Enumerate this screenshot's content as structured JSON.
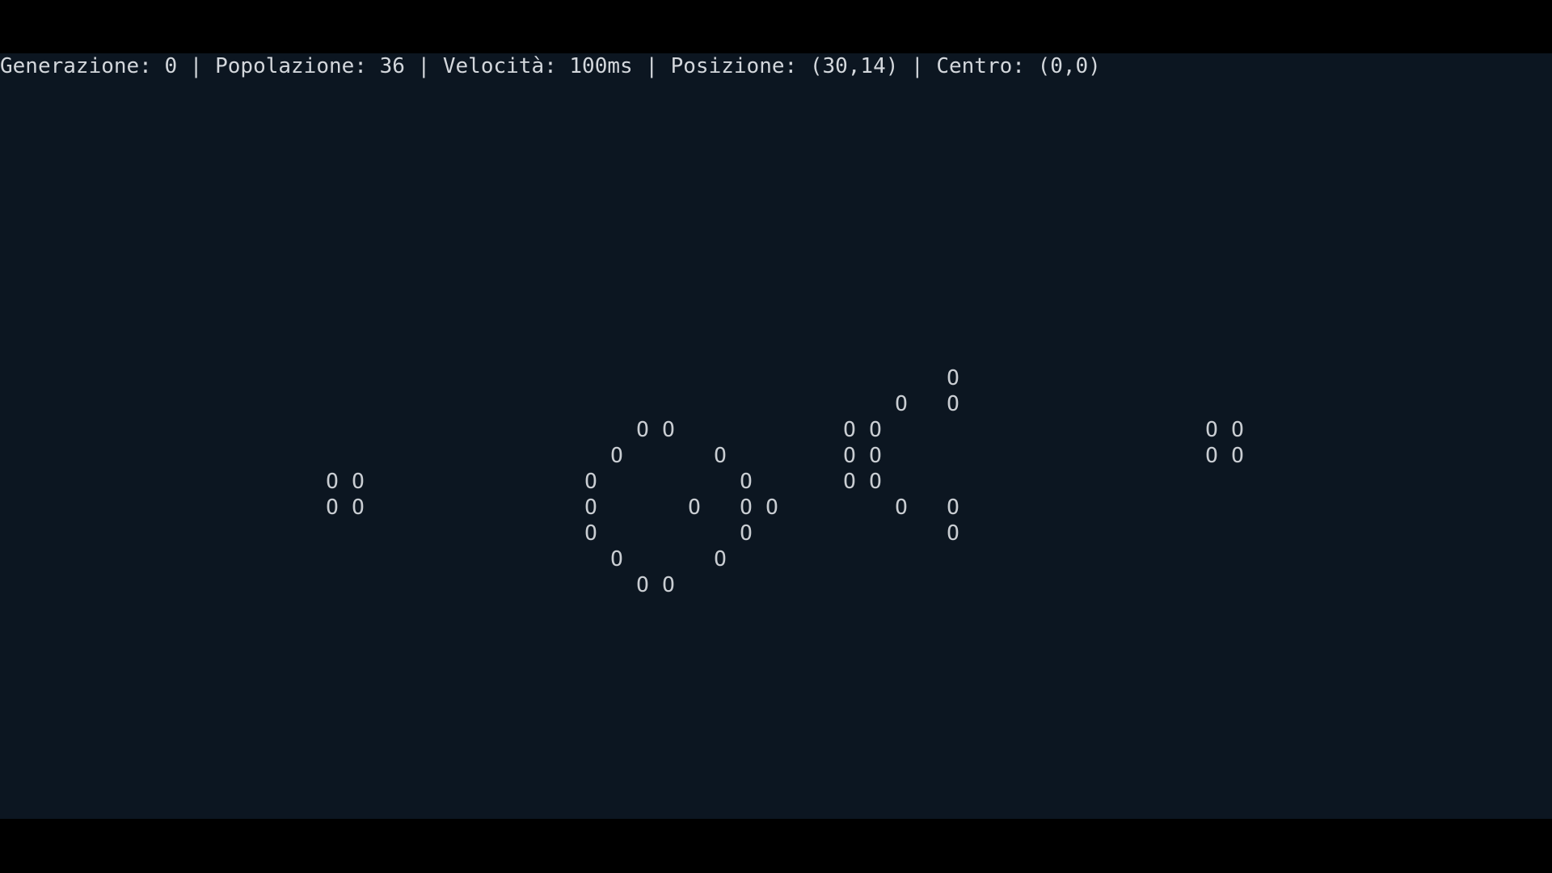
{
  "status": {
    "text": "Generazione: 0 | Popolazione: 36 | Velocità: 100ms | Posizione: (30,14) | Centro: (0,0)",
    "generation": 0,
    "population": 36,
    "speed": "100ms",
    "position": "(30,14)",
    "center": "(0,0)"
  },
  "cell_glyph": "O",
  "colors": {
    "background": "#0c1621",
    "cell": "#c9cdd2",
    "status_text": "#d3d7dc"
  },
  "live_cells": [
    [
      36,
      0
    ],
    [
      34,
      1
    ],
    [
      36,
      1
    ],
    [
      24,
      2
    ],
    [
      25,
      2
    ],
    [
      32,
      2
    ],
    [
      33,
      2
    ],
    [
      46,
      2
    ],
    [
      47,
      2
    ],
    [
      23,
      3
    ],
    [
      27,
      3
    ],
    [
      32,
      3
    ],
    [
      33,
      3
    ],
    [
      46,
      3
    ],
    [
      47,
      3
    ],
    [
      12,
      4
    ],
    [
      13,
      4
    ],
    [
      22,
      4
    ],
    [
      28,
      4
    ],
    [
      32,
      4
    ],
    [
      33,
      4
    ],
    [
      12,
      5
    ],
    [
      13,
      5
    ],
    [
      22,
      5
    ],
    [
      26,
      5
    ],
    [
      28,
      5
    ],
    [
      29,
      5
    ],
    [
      34,
      5
    ],
    [
      36,
      5
    ],
    [
      22,
      6
    ],
    [
      28,
      6
    ],
    [
      36,
      6
    ],
    [
      23,
      7
    ],
    [
      27,
      7
    ],
    [
      24,
      8
    ],
    [
      25,
      8
    ]
  ]
}
